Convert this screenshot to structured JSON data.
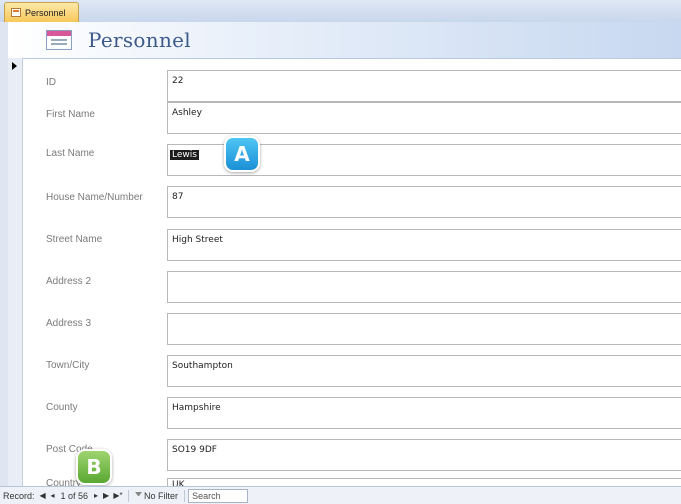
{
  "tab": {
    "label": "Personnel"
  },
  "header": {
    "title": "Personnel"
  },
  "fields": [
    {
      "label": "ID",
      "value": "22"
    },
    {
      "label": "First Name",
      "value": "Ashley"
    },
    {
      "label": "Last Name",
      "value": "Lewis"
    },
    {
      "label": "House Name/Number",
      "value": "87"
    },
    {
      "label": "Street Name",
      "value": "High Street"
    },
    {
      "label": "Address 2",
      "value": ""
    },
    {
      "label": "Address 3",
      "value": ""
    },
    {
      "label": "Town/City",
      "value": "Southampton"
    },
    {
      "label": "County",
      "value": "Hampshire"
    },
    {
      "label": "Post Code",
      "value": "SO19 9DF"
    },
    {
      "label": "Country",
      "value": "UK"
    }
  ],
  "callouts": {
    "a": "A",
    "b": "B"
  },
  "navbar": {
    "record_label": "Record:",
    "first": "◀",
    "prev": "◂",
    "position": "1 of 56",
    "next": "▸",
    "last": "▶",
    "new": "▶*",
    "filter": "No Filter",
    "search": "Search"
  },
  "colors": {
    "callout_a": "#1a8fd6",
    "callout_b": "#5aa832",
    "title": "#3c5a8a",
    "tab": "#f7c75a"
  }
}
